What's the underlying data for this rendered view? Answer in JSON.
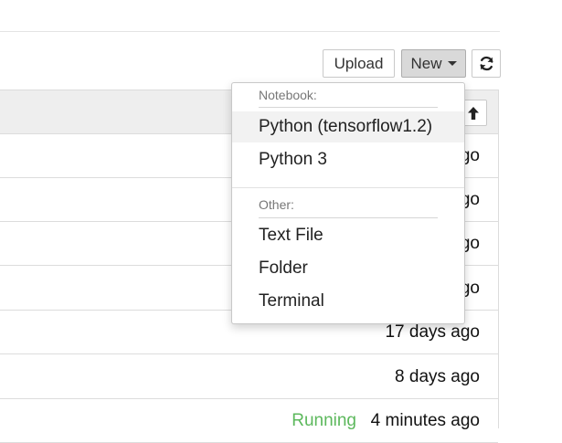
{
  "toolbar": {
    "upload_label": "Upload",
    "new_label": "New",
    "refresh_icon": "refresh-icon",
    "caret_icon": "caret-down-icon"
  },
  "list": {
    "sort_icon": "arrow-up-icon",
    "rows": [
      {
        "time": "ago"
      },
      {
        "time": "ago"
      },
      {
        "time": "ago"
      },
      {
        "time": "ago"
      },
      {
        "time": "17 days ago"
      },
      {
        "time": "8 days ago"
      },
      {
        "status": "Running",
        "time": "4 minutes ago"
      }
    ],
    "running_color": "#5cb85c"
  },
  "new_menu": {
    "notebook_header": "Notebook:",
    "notebook_items": [
      "Python (tensorflow1.2)",
      "Python 3"
    ],
    "other_header": "Other:",
    "other_items": [
      "Text File",
      "Folder",
      "Terminal"
    ]
  }
}
